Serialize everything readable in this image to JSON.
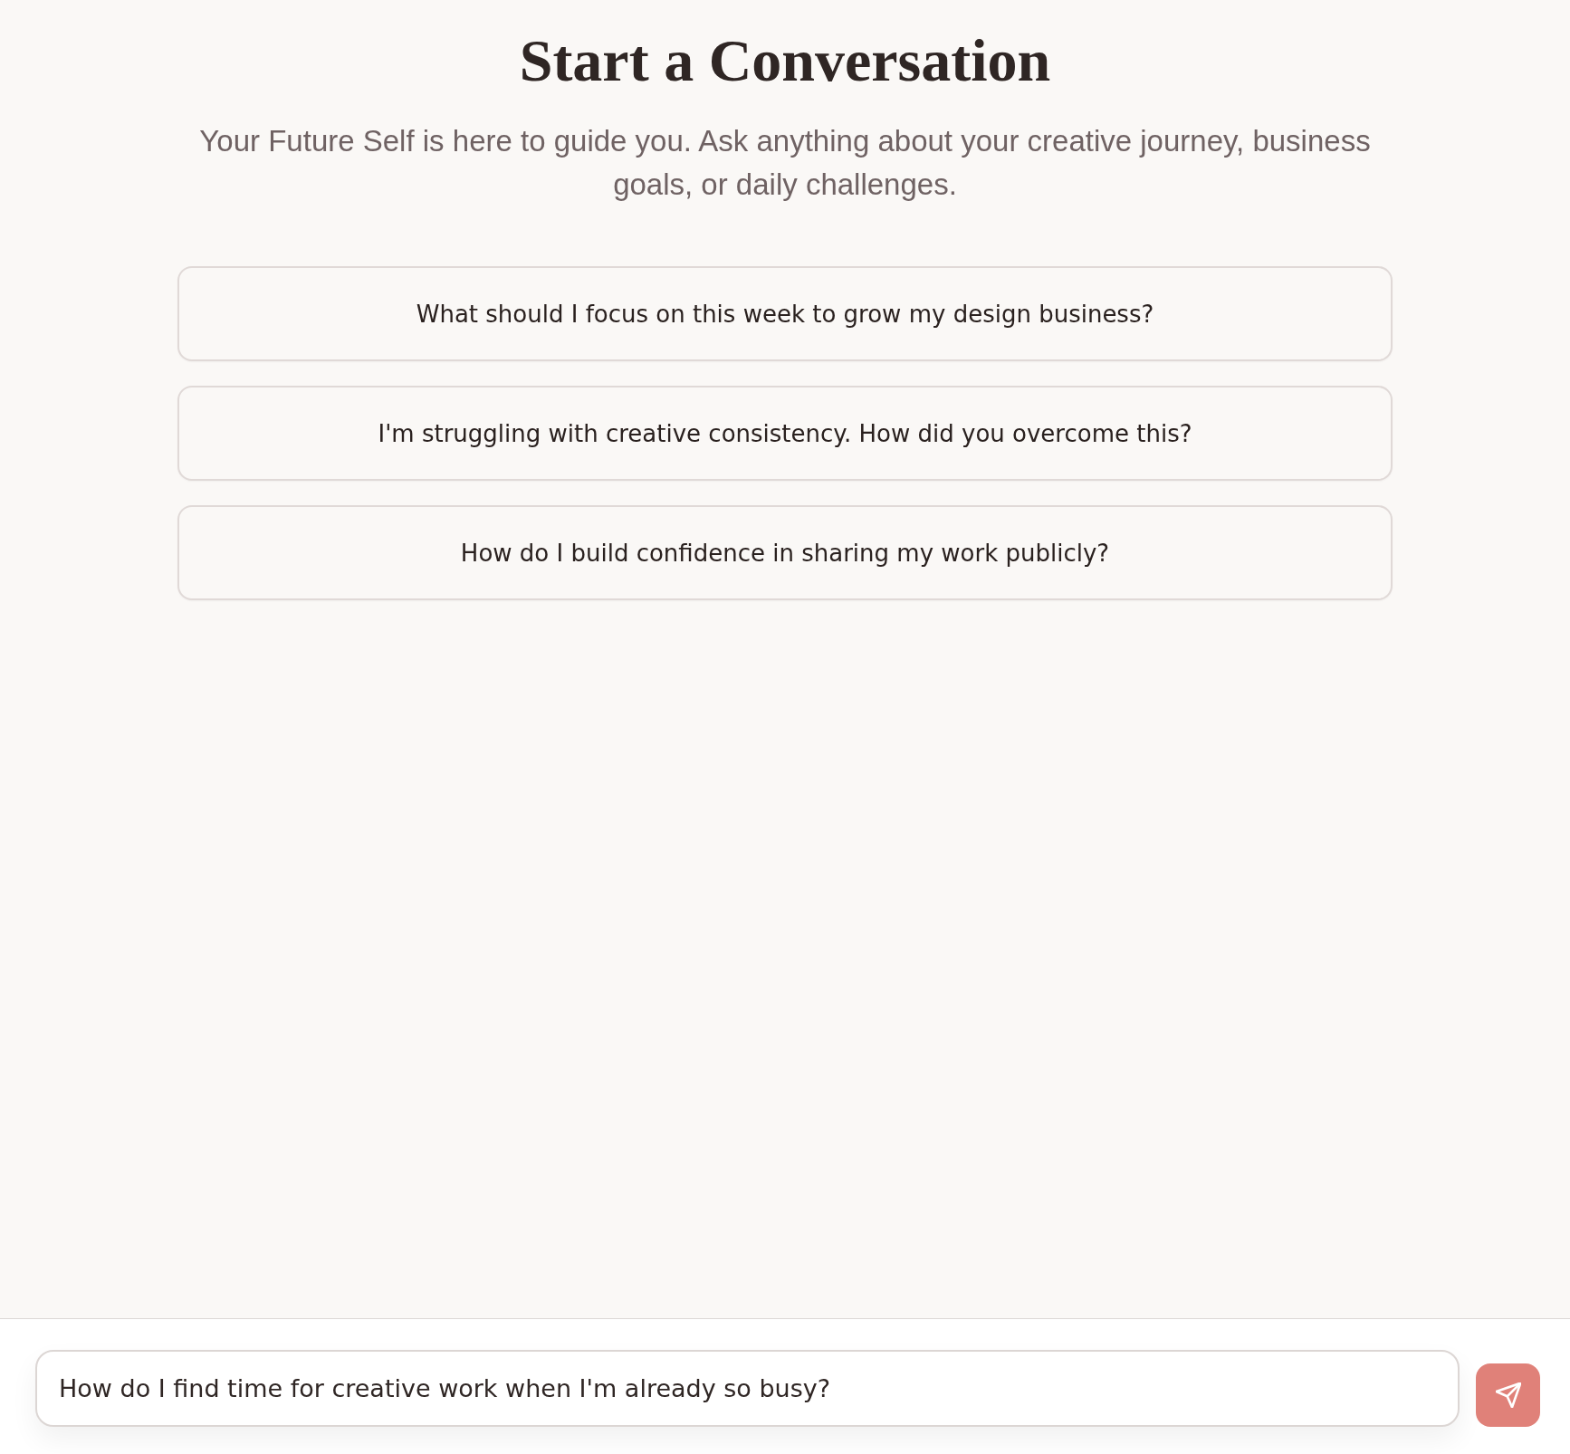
{
  "heading": {
    "title": "Start a Conversation",
    "subtitle": "Your Future Self is here to guide you. Ask anything about your creative journey, business goals, or daily challenges."
  },
  "suggestions": [
    {
      "text": "What should I focus on this week to grow my design business?"
    },
    {
      "text": "I'm struggling with creative consistency. How did you overcome this?"
    },
    {
      "text": "How do I build confidence in sharing my work publicly?"
    }
  ],
  "composer": {
    "value": "How do I find time for creative work when I'm already so busy?"
  }
}
